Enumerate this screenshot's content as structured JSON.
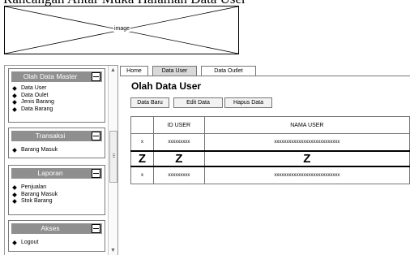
{
  "caption": "Rancangan Antar Muka Halaman Data User",
  "image_placeholder": "image",
  "sidebar": {
    "panels": [
      {
        "title": "Olah Data Master",
        "items": [
          "Data User",
          "Data Oulet",
          "Jenis Barang",
          "Data Barang"
        ]
      },
      {
        "title": "Transaksi",
        "items": [
          "Barang Masuk"
        ]
      },
      {
        "title": "Laporan",
        "items": [
          "Penjualan",
          "Barang Masuk",
          "Stok Barang"
        ]
      },
      {
        "title": "Akses",
        "items": [
          "Logout"
        ]
      }
    ]
  },
  "tabs": [
    "Home",
    "Data User",
    "Data Outlet"
  ],
  "active_tab": "Data User",
  "page_title": "Olah Data User",
  "buttons": [
    "Data Baru",
    "Edit Data",
    "Hapus Data"
  ],
  "table": {
    "headers": [
      "",
      "ID USER",
      "NAMA USER"
    ],
    "rows": [
      [
        "x",
        "xxxxxxxxx",
        "xxxxxxxxxxxxxxxxxxxxxxxxxxx"
      ],
      [
        "Z",
        "Z",
        "Z"
      ],
      [
        "x",
        "xxxxxxxxx",
        "xxxxxxxxxxxxxxxxxxxxxxxxxxx"
      ]
    ]
  }
}
